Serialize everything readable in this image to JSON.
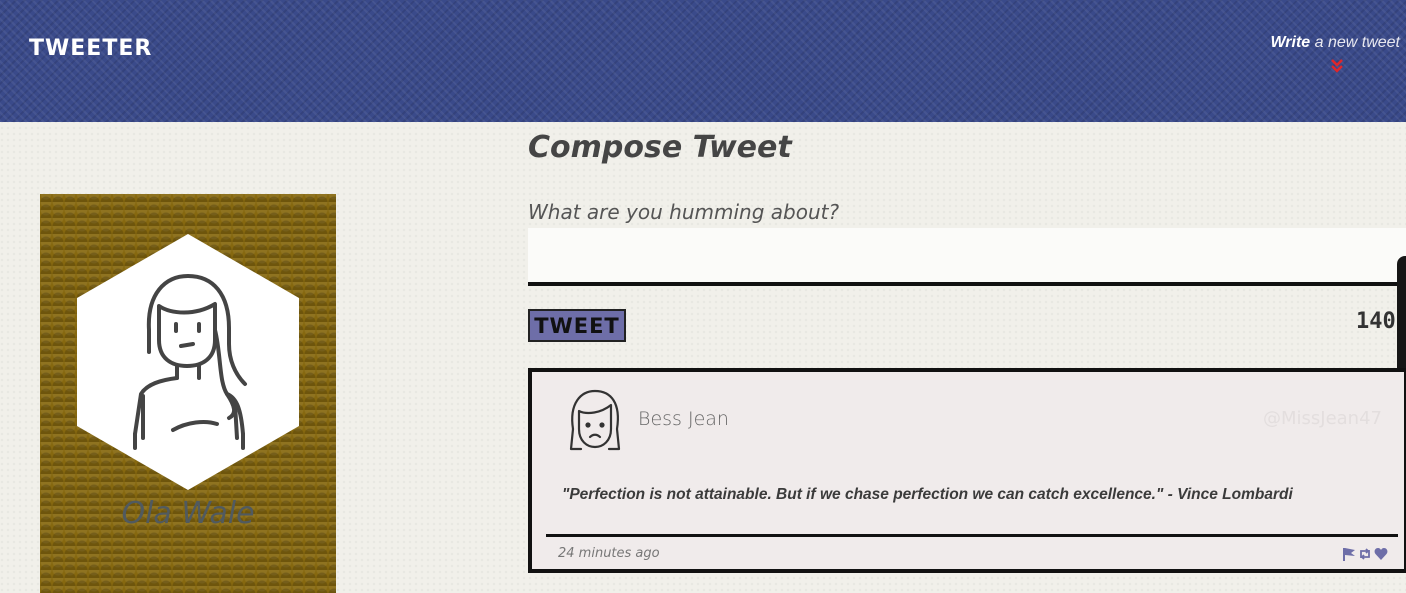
{
  "header": {
    "brand": "TWEETER",
    "write_bold": "Write",
    "write_rest": " a new tweet",
    "chevron_icon": "double-chevron-down-icon",
    "chevron_color": "#e0262a"
  },
  "profile": {
    "name": "Ola Wale",
    "avatar_icon": "girl-avatar-icon"
  },
  "compose": {
    "title": "Compose Tweet",
    "label": "What are you humming about?",
    "input_value": "",
    "button_label": "TWEET",
    "counter": "140"
  },
  "tweet": {
    "name": "Bess Jean",
    "handle": "@MissJean47",
    "text": "\"Perfection is not attainable. But if we chase perfection we can catch excellence.\" - Vince Lombardi",
    "time": "24 minutes ago",
    "actions": [
      "flag-icon",
      "retweet-icon",
      "heart-icon"
    ],
    "action_color": "#6e6ea8"
  },
  "colors": {
    "header_bg": "#3a4a8a",
    "profile_bg": "#86680f",
    "button_bg": "#6e6ea8"
  }
}
